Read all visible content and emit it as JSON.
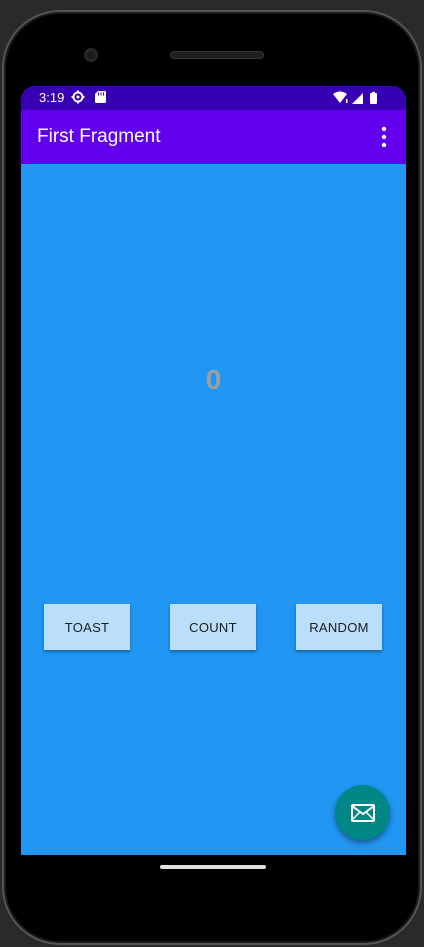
{
  "status_bar": {
    "time": "3:19",
    "icons": [
      "settings-gear-icon",
      "sd-card-icon",
      "wifi-icon",
      "signal-icon",
      "battery-icon"
    ],
    "background_color": "#3700b3"
  },
  "app_bar": {
    "title": "First Fragment",
    "overflow_icon": "more-vert-icon",
    "background_color": "#6200ee"
  },
  "main": {
    "background_color": "#2196f3",
    "counter_value": "0",
    "buttons": [
      {
        "label": "TOAST"
      },
      {
        "label": "COUNT"
      },
      {
        "label": "RANDOM"
      }
    ],
    "button_color": "#bbdefb"
  },
  "fab": {
    "icon": "email-icon",
    "background_color": "#018786"
  }
}
